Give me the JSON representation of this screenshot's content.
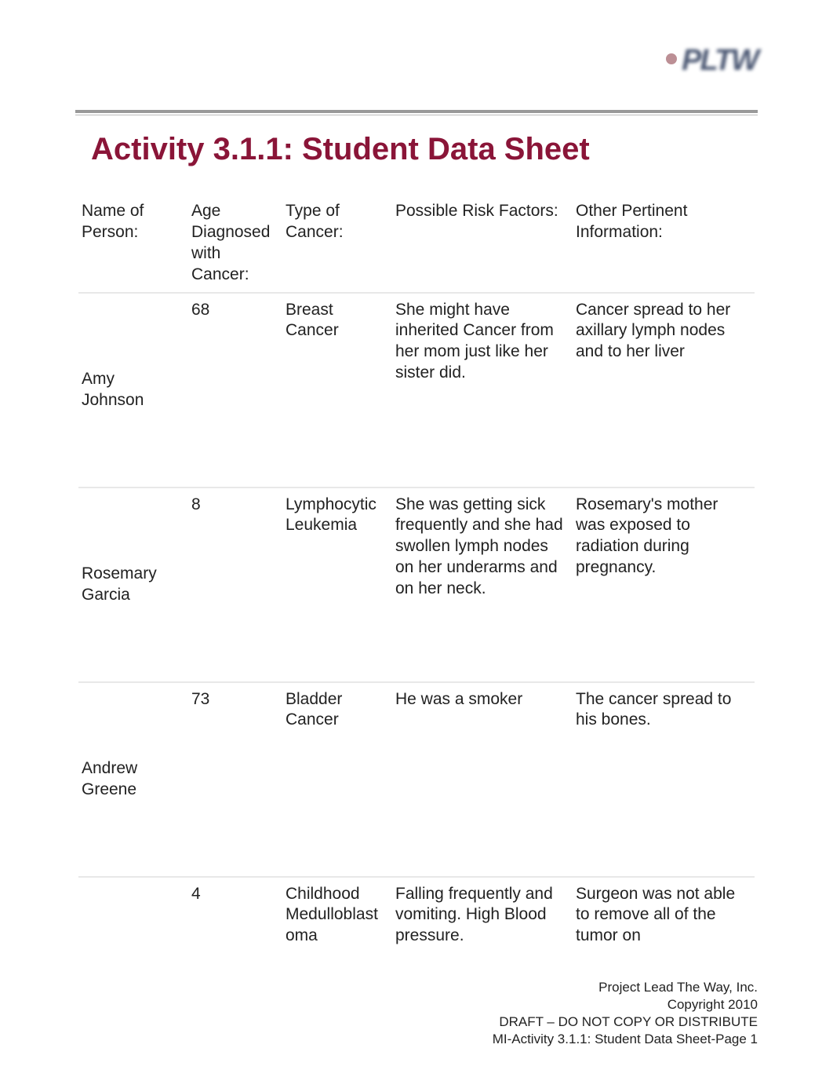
{
  "logo": {
    "text": "PLTW"
  },
  "title": "Activity 3.1.1: Student Data Sheet",
  "columns": {
    "name": "Name of Person:",
    "age": "Age Diagnosed with Cancer:",
    "type": "Type of Cancer:",
    "risk": "Possible Risk Factors:",
    "other": "Other Pertinent Information:"
  },
  "rows": [
    {
      "name": "Amy Johnson",
      "age": "68",
      "type": "Breast Cancer",
      "risk": "She might have inherited Cancer from her mom just like her sister did.",
      "other": " Cancer spread to her axillary lymph nodes and to her liver"
    },
    {
      "name": "Rosemary Garcia",
      "age": "8",
      "type": "Lymphocytic Leukemia",
      "risk": "She was getting sick frequently and she had swollen lymph nodes on her underarms and on her neck.",
      "other": "Rosemary's mother was exposed to radiation during pregnancy."
    },
    {
      "name": "Andrew Greene",
      "age": "73",
      "type": "Bladder Cancer",
      "risk": "He was a smoker",
      "other": "The cancer spread to his bones."
    },
    {
      "name": "",
      "age": "4",
      "type": "Childhood Medulloblastoma",
      "risk": "Falling frequently and vomiting. High Blood pressure.",
      "other": "Surgeon was not able to remove all of the tumor on"
    }
  ],
  "footer": {
    "line1": "Project Lead The Way, Inc.",
    "line2": "Copyright 2010",
    "line3": "DRAFT – DO NOT COPY OR DISTRIBUTE",
    "line4": "MI-Activity 3.1.1: Student Data Sheet-Page 1"
  }
}
